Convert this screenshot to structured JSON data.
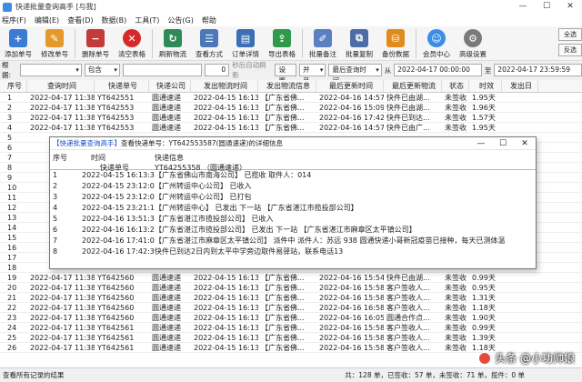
{
  "window": {
    "title": "快递批量查询高手 [与我]",
    "minimize": "—",
    "maximize": "☐",
    "close": "✕"
  },
  "menu": [
    "程序(F)",
    "编辑(E)",
    "查看(D)",
    "数据(B)",
    "工具(T)",
    "公告(G)",
    "帮助"
  ],
  "toolbar": [
    {
      "label": "添加单号",
      "icon": "add-doc-icon",
      "color": "#3a7bd5"
    },
    {
      "label": "修改单号",
      "icon": "edit-icon",
      "color": "#e49a2b"
    },
    {
      "label": "删除单号",
      "icon": "delete-icon",
      "color": "#c23a3a"
    },
    {
      "label": "清空表格",
      "icon": "clear-icon",
      "color": "#d42a2a"
    },
    {
      "label": "刷新物流",
      "icon": "refresh-icon",
      "color": "#2e8b57"
    },
    {
      "label": "查看方式",
      "icon": "view-icon",
      "color": "#4a78b8"
    },
    {
      "label": "订单详情",
      "icon": "detail-icon",
      "color": "#3d6fb6"
    },
    {
      "label": "导出表格",
      "icon": "export-icon",
      "color": "#2f9a4a"
    },
    {
      "label": "批量备注",
      "icon": "note-icon",
      "color": "#5b7fc0"
    },
    {
      "label": "批量复制",
      "icon": "copy-icon",
      "color": "#4e6da6"
    },
    {
      "label": "备份数据",
      "icon": "backup-icon",
      "color": "#e28b1d"
    },
    {
      "label": "会员中心",
      "icon": "member-icon",
      "color": "#3a8ee6"
    },
    {
      "label": "高级设置",
      "icon": "settings-icon",
      "color": "#7a7a7a"
    }
  ],
  "rightpanel": [
    "全选",
    "反选"
  ],
  "filter": {
    "label": "根据:",
    "contains": "包含",
    "interval": "0",
    "auto_refresh": "秒后自动刷新",
    "settings_btn": "设置",
    "logic": "并且",
    "date_field": "最后查询时间",
    "from": "从",
    "from_value": "2022-04-17 00:00:00",
    "to": "至",
    "to_value": "2022-04-17 23:59:59"
  },
  "grid": {
    "columns": [
      "序号",
      "查询时间",
      "快递单号",
      "快递公司",
      "发出物流时间",
      "发出物流信息",
      "最后更新时间",
      "最后更新物流",
      "状态",
      "时效",
      "发出日"
    ],
    "rows": [
      [
        "1",
        "2022-04-17 11:38:32",
        "YT642551",
        "圆通速递",
        "2022-04-15 16:13:30",
        "【广东省佛...",
        "2022-04-16 14:57:33",
        "快件已由湖...",
        "未签收",
        "1.95天",
        ""
      ],
      [
        "2",
        "2022-04-17 11:38:34",
        "YT642553",
        "圆通速递",
        "2022-04-15 16:13:30",
        "【广东省佛...",
        "2022-04-16 15:09:54",
        "快件已由湖...",
        "未签收",
        "1.96天",
        ""
      ],
      [
        "3",
        "2022-04-17 11:38:32",
        "YT642553",
        "圆通速递",
        "2022-04-15 16:13:30",
        "【广东省佛...",
        "2022-04-16 17:42:31",
        "快件已到达...",
        "未签收",
        "1.57天",
        ""
      ],
      [
        "4",
        "2022-04-17 11:38:32",
        "YT642553",
        "圆通速递",
        "2022-04-15 16:13:30",
        "【广东省佛...",
        "2022-04-16 14:57:33",
        "快件已由广...",
        "未签收",
        "1.95天",
        ""
      ],
      [
        "5",
        "",
        "",
        "",
        "",
        "",
        "",
        "",
        "",
        "",
        ""
      ],
      [
        "6",
        "",
        "",
        "",
        "",
        "",
        "",
        "",
        "",
        "",
        ""
      ],
      [
        "7",
        "",
        "",
        "",
        "",
        "",
        "",
        "",
        "",
        "",
        ""
      ],
      [
        "8",
        "",
        "",
        "",
        "",
        "",
        "",
        "",
        "",
        "",
        ""
      ],
      [
        "9",
        "",
        "",
        "",
        "",
        "",
        "",
        "",
        "",
        "",
        ""
      ],
      [
        "10",
        "",
        "",
        "",
        "",
        "",
        "",
        "",
        "",
        "",
        ""
      ],
      [
        "11",
        "",
        "",
        "",
        "",
        "",
        "",
        "",
        "",
        "",
        ""
      ],
      [
        "12",
        "",
        "",
        "",
        "",
        "",
        "",
        "",
        "",
        "",
        ""
      ],
      [
        "13",
        "",
        "",
        "",
        "",
        "",
        "",
        "",
        "",
        "",
        ""
      ],
      [
        "14",
        "",
        "",
        "",
        "",
        "",
        "",
        "",
        "",
        "",
        ""
      ],
      [
        "15",
        "",
        "",
        "",
        "",
        "",
        "",
        "",
        "",
        "",
        ""
      ],
      [
        "16",
        "",
        "",
        "",
        "",
        "",
        "",
        "",
        "",
        "",
        ""
      ],
      [
        "17",
        "",
        "",
        "",
        "",
        "",
        "",
        "",
        "",
        "",
        ""
      ],
      [
        "18",
        "",
        "",
        "",
        "",
        "",
        "",
        "",
        "",
        "",
        ""
      ],
      [
        "19",
        "2022-04-17 11:38:32",
        "YT642560",
        "圆通速递",
        "2022-04-15 16:13:30",
        "【广东省佛...",
        "2022-04-16 15:54:09",
        "快件已由湖...",
        "未签收",
        "0.99天",
        ""
      ],
      [
        "20",
        "2022-04-17 11:38:41",
        "YT642560",
        "圆通速递",
        "2022-04-15 16:13:30",
        "【广东省佛...",
        "2022-04-16 15:58:20",
        "客户签收人...",
        "未签收",
        "0.95天",
        ""
      ],
      [
        "21",
        "2022-04-17 11:38:32",
        "YT642560",
        "圆通速递",
        "2022-04-15 16:13:30",
        "【广东省佛...",
        "2022-04-16 15:58:09",
        "客户签收人...",
        "未签收",
        "1.31天",
        ""
      ],
      [
        "22",
        "2022-04-17 11:38:40",
        "YT642560",
        "圆通速递",
        "2022-04-15 16:13:30",
        "【广东省佛...",
        "2022-04-16 16:58:09",
        "客户签收人...",
        "未签收",
        "1.18天",
        ""
      ],
      [
        "23",
        "2022-04-17 11:38:41",
        "YT642560",
        "圆通速递",
        "2022-04-15 16:13:30",
        "【广东省佛...",
        "2022-04-16 16:05:41",
        "圆通合作点...",
        "未签收",
        "1.90天",
        ""
      ],
      [
        "24",
        "2022-04-17 11:38:32",
        "YT642561",
        "圆通速递",
        "2022-04-15 16:13:30",
        "【广东省佛...",
        "2022-04-16 15:58:09",
        "客户签收人...",
        "未签收",
        "0.99天",
        ""
      ],
      [
        "25",
        "2022-04-17 11:38:32",
        "YT642561",
        "圆通速递",
        "2022-04-15 16:13:30",
        "【广东省佛...",
        "2022-04-16 15:58:09",
        "客户签收人...",
        "未签收",
        "1.39天",
        ""
      ],
      [
        "26",
        "2022-04-17 11:38:41",
        "YT642561",
        "圆通速递",
        "2022-04-15 16:13:30",
        "【广东省佛...",
        "2022-04-16 15:58:09",
        "客户签收人...",
        "未签收",
        "1.18天",
        ""
      ]
    ]
  },
  "dialog": {
    "title_prefix": "【快递批量查询高手】",
    "title_rest": "查看快递单号：YT642553587(圆通速递)的详细信息",
    "col_no": "序号",
    "col_time": "时间",
    "col_info": "快递信息",
    "col_tracking": "快递单号",
    "tracking_value": "YT64255358 （圆通速递）",
    "rows": [
      {
        "n": "1",
        "t": "2022-04-15 16:13:30",
        "i": "【广东省佛山市南海公司】 已揽收 取件人：014"
      },
      {
        "n": "2",
        "t": "2022-04-15 23:12:07",
        "i": "【广州转运中心公司】 已收入"
      },
      {
        "n": "3",
        "t": "2022-04-15 23:12:07",
        "i": "【广州转运中心公司】 已打包"
      },
      {
        "n": "4",
        "t": "2022-04-15 23:21:15",
        "i": "【广州转运中心】 已发出 下一站 【广东省湛江市揽投部公司】"
      },
      {
        "n": "5",
        "t": "2022-04-16 13:51:30",
        "i": "【广东省湛江市揽投部公司】 已收入"
      },
      {
        "n": "6",
        "t": "2022-04-16 16:13:20",
        "i": "【广东省湛江市揽投部公司】 已发出 下一站 【广东省湛江市麻章区太平镇公司】"
      },
      {
        "n": "7",
        "t": "2022-04-16 17:41:00",
        "i": "【广东省湛江市麻章区太平镇公司】 派件中 派件人：苏远 938 圆通快递小哥新冠疫苗已接种，每天已测体温"
      },
      {
        "n": "8",
        "t": "2022-04-16 17:42:31",
        "i": "快件已到达2日内到太平中学旁边取件易驿站，联系电话13"
      }
    ]
  },
  "status": {
    "left": "查看所有记录的结果",
    "right": "共：128 单，已签收：57 单，未签收：71 单，揽件：0 单"
  },
  "watermark": "头条 @小功帅娘"
}
